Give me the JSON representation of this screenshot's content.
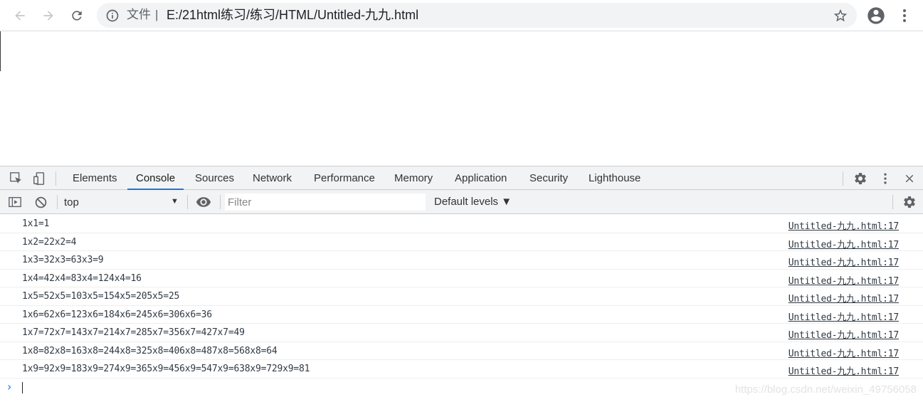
{
  "browser": {
    "omnibox": {
      "security_label": "文件",
      "separator": "|",
      "url": "E:/21html练习/练习/HTML/Untitled-九九.html"
    },
    "icons": {
      "back": "arrow-left-icon",
      "forward": "arrow-right-icon",
      "reload": "reload-icon",
      "info": "info-icon",
      "bookmark": "star-icon",
      "profile": "account-circle-icon",
      "menu": "kebab-menu-icon"
    }
  },
  "devtools": {
    "tabs": [
      {
        "label": "Elements"
      },
      {
        "label": "Console"
      },
      {
        "label": "Sources"
      },
      {
        "label": "Network"
      },
      {
        "label": "Performance"
      },
      {
        "label": "Memory"
      },
      {
        "label": "Application"
      },
      {
        "label": "Security"
      },
      {
        "label": "Lighthouse"
      }
    ],
    "active_tab": "Console",
    "console_toolbar": {
      "context": "top",
      "filter_placeholder": "Filter",
      "levels_label": "Default levels ▼"
    },
    "accent_color": "#1a73e8",
    "logs": [
      {
        "text": "1x1=1",
        "source": "Untitled-九九.html:17"
      },
      {
        "text": "1x2=22x2=4",
        "source": "Untitled-九九.html:17"
      },
      {
        "text": "1x3=32x3=63x3=9",
        "source": "Untitled-九九.html:17"
      },
      {
        "text": "1x4=42x4=83x4=124x4=16",
        "source": "Untitled-九九.html:17"
      },
      {
        "text": "1x5=52x5=103x5=154x5=205x5=25",
        "source": "Untitled-九九.html:17"
      },
      {
        "text": "1x6=62x6=123x6=184x6=245x6=306x6=36",
        "source": "Untitled-九九.html:17"
      },
      {
        "text": "1x7=72x7=143x7=214x7=285x7=356x7=427x7=49",
        "source": "Untitled-九九.html:17"
      },
      {
        "text": "1x8=82x8=163x8=244x8=325x8=406x8=487x8=568x8=64",
        "source": "Untitled-九九.html:17"
      },
      {
        "text": "1x9=92x9=183x9=274x9=365x9=456x9=547x9=638x9=729x9=81",
        "source": "Untitled-九九.html:17"
      }
    ],
    "prompt_symbol": "›"
  },
  "watermark": "https://blog.csdn.net/weixin_49756058"
}
